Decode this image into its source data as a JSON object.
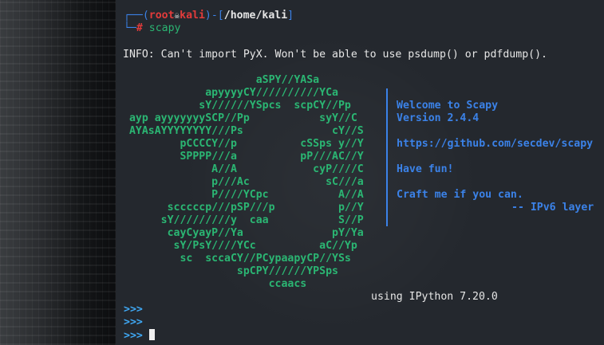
{
  "prompt": {
    "line1_open": "┌──(",
    "user": "root",
    "skull_glyph": "☠",
    "host": "kali",
    "dir_sep": ")-[",
    "cwd": "/home/kali",
    "line1_close": "]",
    "line2_prefix": "└─",
    "hash": "#",
    "command": "scapy"
  },
  "info_message": "INFO: Can't import PyX. Won't be able to use psdump() or pdfdump().",
  "logo_lines": [
    "                     aSPY//YASa",
    "             apyyyyCY//////////YCa",
    "            sY//////YSpcs  scpCY//Pp",
    " ayp ayyyyyyySCP//Pp           syY//C",
    " AYAsAYYYYYYYY///Ps              cY//S",
    "         pCCCCY//p          cSSps y//Y",
    "         SPPPP///a          pP///AC//Y",
    "              A//A            cyP////C",
    "              p///Ac            sC///a",
    "              P////YCpc           A//A",
    "       scccccp///pSP///p          p//Y",
    "      sY/////////y  caa           S//P",
    "       cayCyayP//Ya              pY/Ya",
    "        sY/PsY////YCc          aC//Yp",
    "         sc  sccaCY//PCypaapyCP//YSs",
    "                  spCPY//////YPSps",
    "                       ccaacs"
  ],
  "banner": {
    "welcome": "Welcome to Scapy",
    "version": "Version 2.4.4",
    "url": "https://github.com/secdev/scapy",
    "have_fun": "Have fun!",
    "quote": "Craft me if you can.",
    "quote_author": "-- IPv6 layer"
  },
  "ipython_line": "using IPython 7.20.0",
  "repl_prompt": ">>>",
  "colors": {
    "terminal_bg": "#24282e",
    "prompt_blue": "#3b82e8",
    "prompt_red": "#e23b3b",
    "art_green": "#2bb673",
    "banner_blue": "#3b82e8",
    "repl_cyan": "#3fa9f5"
  }
}
